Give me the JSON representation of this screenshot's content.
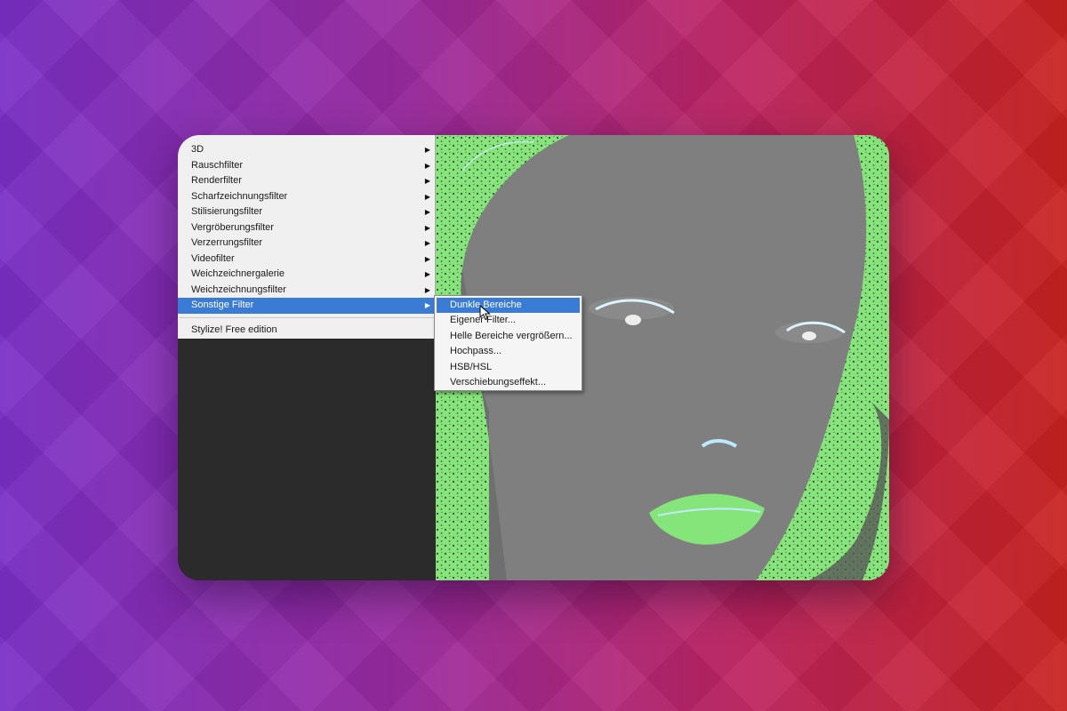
{
  "menu": {
    "items": [
      {
        "label": "3D"
      },
      {
        "label": "Rauschfilter"
      },
      {
        "label": "Renderfilter"
      },
      {
        "label": "Scharfzeichnungsfilter"
      },
      {
        "label": "Stilisierungsfilter"
      },
      {
        "label": "Vergröberungsfilter"
      },
      {
        "label": "Verzerrungsfilter"
      },
      {
        "label": "Videofilter"
      },
      {
        "label": "Weichzeichnergalerie"
      },
      {
        "label": "Weichzeichnungsfilter"
      },
      {
        "label": "Sonstige Filter"
      }
    ],
    "plugin_label": "Stylize! Free edition"
  },
  "submenu": {
    "items": [
      {
        "label": "Dunkle Bereiche vergrößern..."
      },
      {
        "label": "Eigener Filter..."
      },
      {
        "label": "Helle Bereiche vergrößern..."
      },
      {
        "label": "Hochpass..."
      },
      {
        "label": "HSB/HSL"
      },
      {
        "label": "Verschiebungseffekt..."
      }
    ]
  },
  "colors": {
    "highlight": "#3a7bd5",
    "photo_gray": "#7f7f7f",
    "photo_green": "#86e57a"
  }
}
